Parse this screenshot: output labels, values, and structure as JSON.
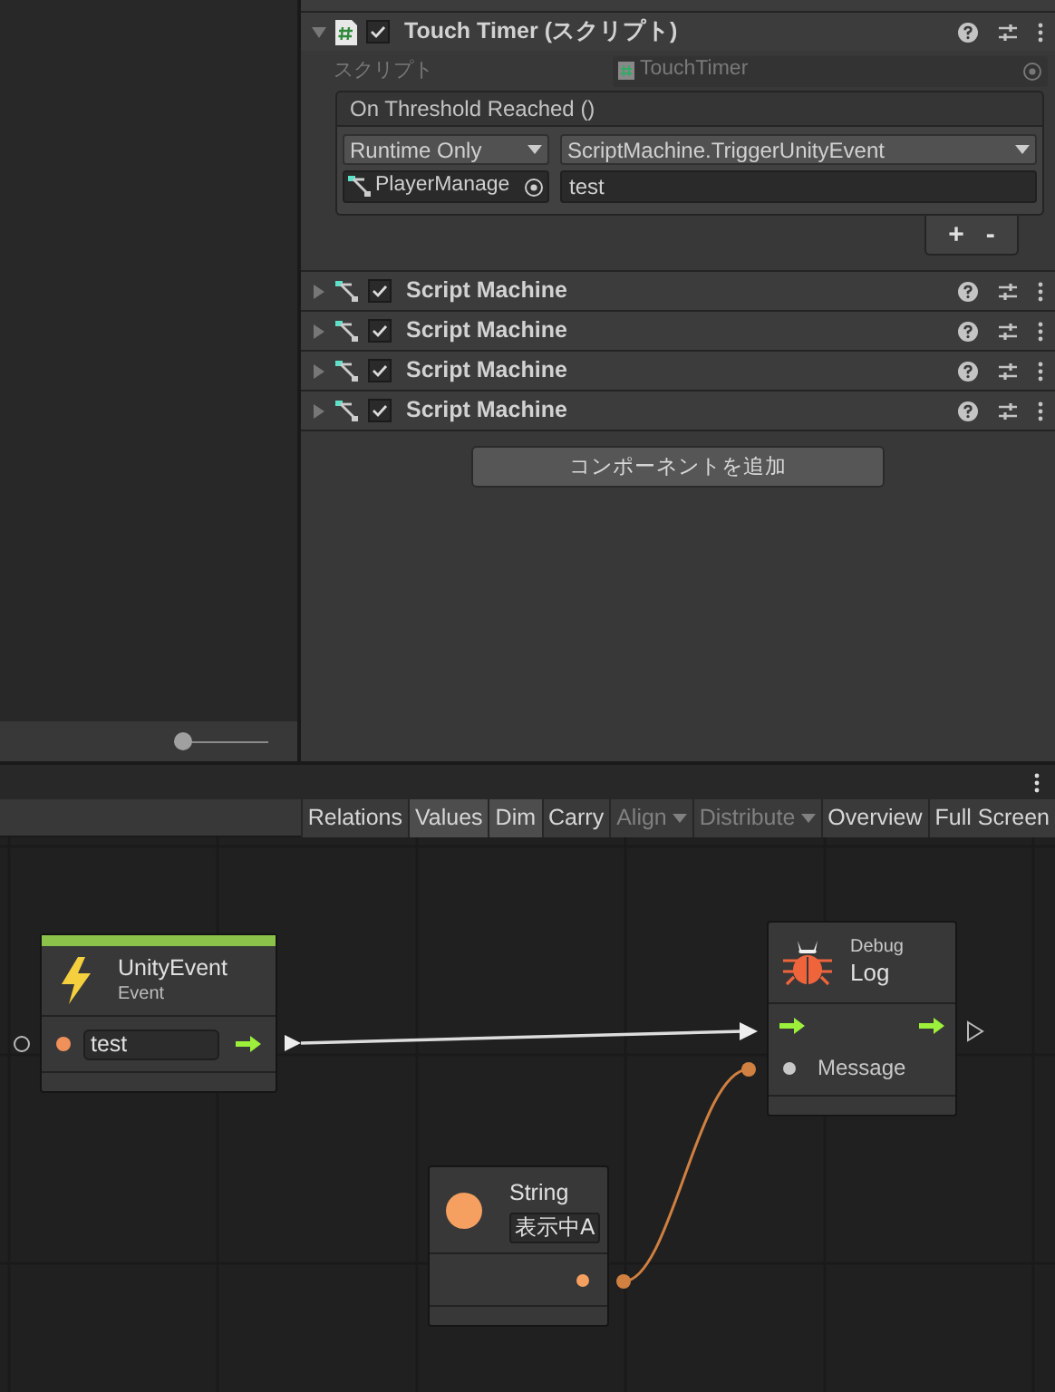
{
  "scene_panel": {
    "zoom_slider": {
      "level": 0
    }
  },
  "inspector": {
    "components": [
      {
        "kind": "script",
        "title": "Touch Timer (スクリプト)",
        "enabled": true,
        "expanded": true,
        "script_field": {
          "label": "スクリプト",
          "value": "TouchTimer"
        },
        "event": {
          "title": "On Threshold Reached ()",
          "mode": "Runtime Only",
          "function": "ScriptMachine.TriggerUnityEvent",
          "target": "PlayerManage",
          "argument": "test",
          "add": "+",
          "remove": "-"
        }
      },
      {
        "kind": "machine",
        "title": "Script Machine",
        "enabled": true,
        "expanded": false
      },
      {
        "kind": "machine",
        "title": "Script Machine",
        "enabled": true,
        "expanded": false
      },
      {
        "kind": "machine",
        "title": "Script Machine",
        "enabled": true,
        "expanded": false
      },
      {
        "kind": "machine",
        "title": "Script Machine",
        "enabled": true,
        "expanded": false
      }
    ],
    "add_button": "コンポーネントを追加"
  },
  "graph": {
    "toolbar": [
      {
        "label": "Relations",
        "selected": false,
        "disabled": false,
        "dropdown": false
      },
      {
        "label": "Values",
        "selected": true,
        "disabled": false,
        "dropdown": false
      },
      {
        "label": "Dim",
        "selected": true,
        "disabled": false,
        "dropdown": false
      },
      {
        "label": "Carry",
        "selected": false,
        "disabled": false,
        "dropdown": false
      },
      {
        "label": "Align",
        "selected": false,
        "disabled": true,
        "dropdown": true
      },
      {
        "label": "Distribute",
        "selected": false,
        "disabled": true,
        "dropdown": true
      },
      {
        "label": "Overview",
        "selected": false,
        "disabled": false,
        "dropdown": false
      },
      {
        "label": "Full Screen",
        "selected": false,
        "disabled": false,
        "dropdown": false
      }
    ],
    "nodes": [
      {
        "kind": "event",
        "title": "UnityEvent",
        "subtitle": "Event",
        "value": "test"
      },
      {
        "kind": "debug",
        "category": "Debug",
        "title": "Log",
        "port": "Message"
      },
      {
        "kind": "literal",
        "title": "String",
        "value": "表示中A"
      }
    ]
  }
}
